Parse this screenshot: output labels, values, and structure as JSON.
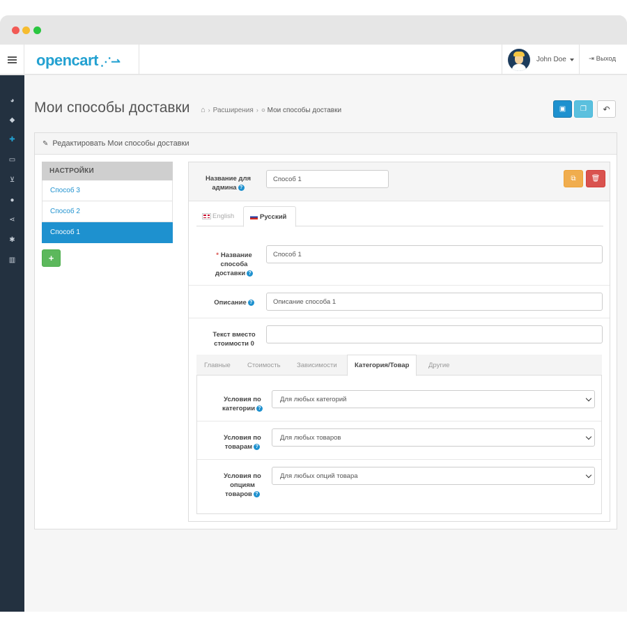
{
  "header": {
    "logo_text": "opencart",
    "logo_cart": "‧‧⇢",
    "user_name": "John Doe",
    "logout_label": "Выход"
  },
  "sidebar": {
    "icons": [
      "dashboard-icon",
      "tag-icon",
      "puzzle-icon",
      "desktop-icon",
      "cart-icon",
      "user-icon",
      "share-icon",
      "cog-icon",
      "chart-icon"
    ]
  },
  "page": {
    "title": "Мои способы доставки",
    "breadcrumb": [
      "Расширения",
      "Мои способы доставки"
    ]
  },
  "panel": {
    "heading": "Редактировать Мои способы доставки"
  },
  "methods_nav": {
    "header": "НАСТРОЙКИ",
    "items": [
      "Способ 3",
      "Способ 2",
      "Способ 1"
    ],
    "active_index": 2,
    "add_label": "+"
  },
  "form": {
    "admin_name_label_1": "Название для",
    "admin_name_label_2": "админа",
    "admin_name_value": "Способ 1",
    "lang_tabs": [
      "English",
      "Русский"
    ],
    "active_lang": "Русский",
    "method_name_label_1": "Название",
    "method_name_label_2": "способа",
    "method_name_label_3": "доставки",
    "method_name_value": "Способ 1",
    "description_label": "Описание",
    "description_value": "Описание способа 1",
    "cost_text_label_1": "Текст вместо",
    "cost_text_label_2": "стоимости 0",
    "cost_text_value": "",
    "sub_tabs": [
      "Главные",
      "Стоимость",
      "Зависимости",
      "Категория/Товар",
      "Другие"
    ],
    "active_sub_tab": "Категория/Товар",
    "category_label_1": "Условия по",
    "category_label_2": "категории",
    "category_value": "Для любых категорий",
    "products_label_1": "Условия по",
    "products_label_2": "товарам",
    "products_value": "Для любых товаров",
    "options_label_1": "Условия по",
    "options_label_2": "опциям",
    "options_label_3": "товаров",
    "options_value": "Для любых опций товара"
  },
  "colors": {
    "primary": "#1e91cf",
    "info": "#5bc0de",
    "success": "#5cb85c",
    "warning": "#f0ad4e",
    "danger": "#d9534f",
    "sidebar": "#233140"
  }
}
